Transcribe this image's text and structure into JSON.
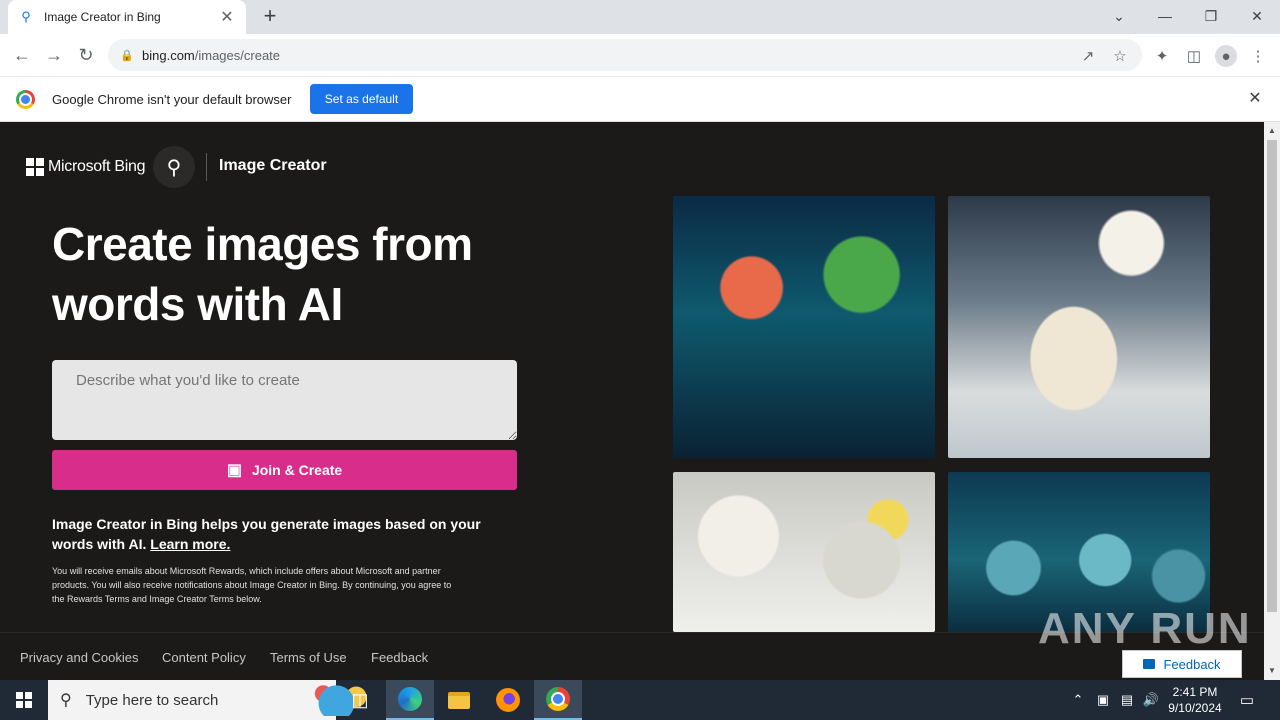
{
  "browser": {
    "tab_title": "Image Creator in Bing",
    "url_domain": "bing.com",
    "url_path": "/images/create",
    "infobar_text": "Google Chrome isn't your default browser",
    "infobar_button": "Set as default"
  },
  "page": {
    "brand": "Microsoft Bing",
    "app_title": "Image Creator",
    "headline": "Create images from words with AI",
    "prompt_placeholder": "Describe what you'd like to create",
    "join_button": "Join & Create",
    "description": "Image Creator in Bing helps you generate images based on your words with AI.",
    "learn_more": "Learn more.",
    "fine_print": "You will receive emails about Microsoft Rewards, which include offers about Microsoft and partner products. You will also receive notifications about Image Creator in Bing. By continuing, you agree to the Rewards Terms and Image Creator Terms below.",
    "footer_links": [
      "Privacy and Cookies",
      "Content Policy",
      "Terms of Use",
      "Feedback"
    ],
    "feedback_button": "Feedback",
    "watermark": "ANY RUN"
  },
  "taskbar": {
    "search_placeholder": "Type here to search",
    "time": "2:41 PM",
    "date": "9/10/2024"
  },
  "colors": {
    "accent_pink": "#d82d8b",
    "chrome_blue": "#1a73e8",
    "page_bg": "#1b1a19"
  },
  "icons": [
    "search-icon",
    "close-icon",
    "plus-icon",
    "back-arrow-icon",
    "forward-arrow-icon",
    "reload-icon",
    "lock-icon",
    "share-icon",
    "star-icon",
    "extensions-icon",
    "sidepanel-icon",
    "profile-icon",
    "menu-icon",
    "image-create-icon",
    "windows-icon",
    "task-view-icon",
    "edge-icon",
    "folder-icon",
    "firefox-icon",
    "chrome-icon"
  ]
}
